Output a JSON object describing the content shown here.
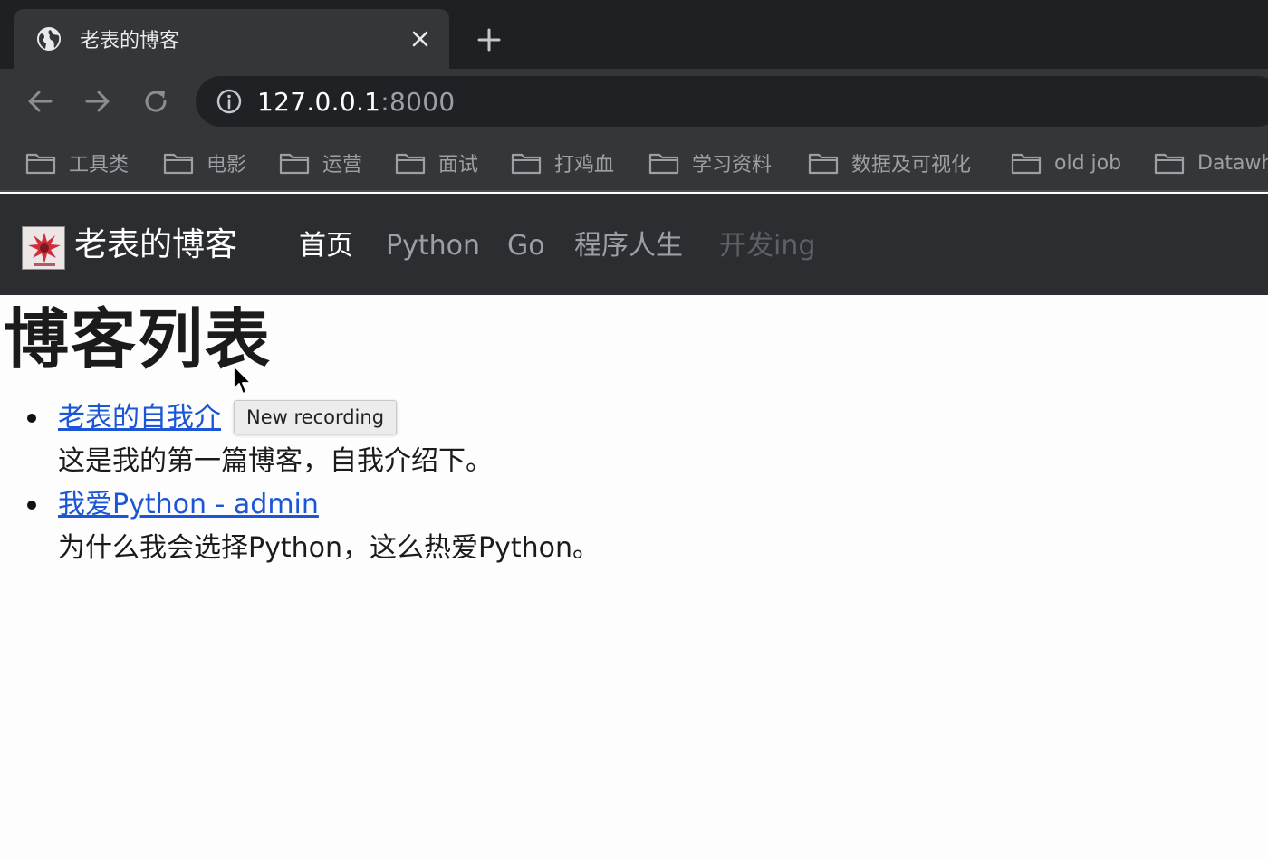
{
  "browser": {
    "tab": {
      "title": "老表的博客"
    },
    "address_bar": {
      "host": "127.0.0.1",
      "port": ":8000"
    },
    "bookmarks": [
      {
        "label": "工具类"
      },
      {
        "label": "电影"
      },
      {
        "label": "运营"
      },
      {
        "label": "面试"
      },
      {
        "label": "打鸡血"
      },
      {
        "label": "学习资料"
      },
      {
        "label": "数据及可视化"
      },
      {
        "label": "old job"
      },
      {
        "label": "Datawh"
      }
    ]
  },
  "site": {
    "brand": "老表的博客",
    "nav": [
      {
        "label": "首页",
        "state": "active"
      },
      {
        "label": "Python",
        "state": "normal"
      },
      {
        "label": "Go",
        "state": "normal"
      },
      {
        "label": "程序人生",
        "state": "normal"
      },
      {
        "label": "开发ing",
        "state": "disabled"
      }
    ]
  },
  "main": {
    "title": "博客列表",
    "posts": [
      {
        "title": "老表的自我介",
        "excerpt": "这是我的第一篇博客，自我介绍下。"
      },
      {
        "title": "我爱Python - admin",
        "excerpt": "为什么我会选择Python，这么热爱Python。"
      }
    ]
  },
  "tooltip": {
    "text": "New recording"
  },
  "colors": {
    "chrome_dark": "#1f2022",
    "chrome": "#353638",
    "navbar": "#2b2d30",
    "link": "#1a56d6",
    "nav_active": "#ffffff",
    "nav_normal": "#9b9ea3",
    "nav_disabled": "#5d6064"
  }
}
